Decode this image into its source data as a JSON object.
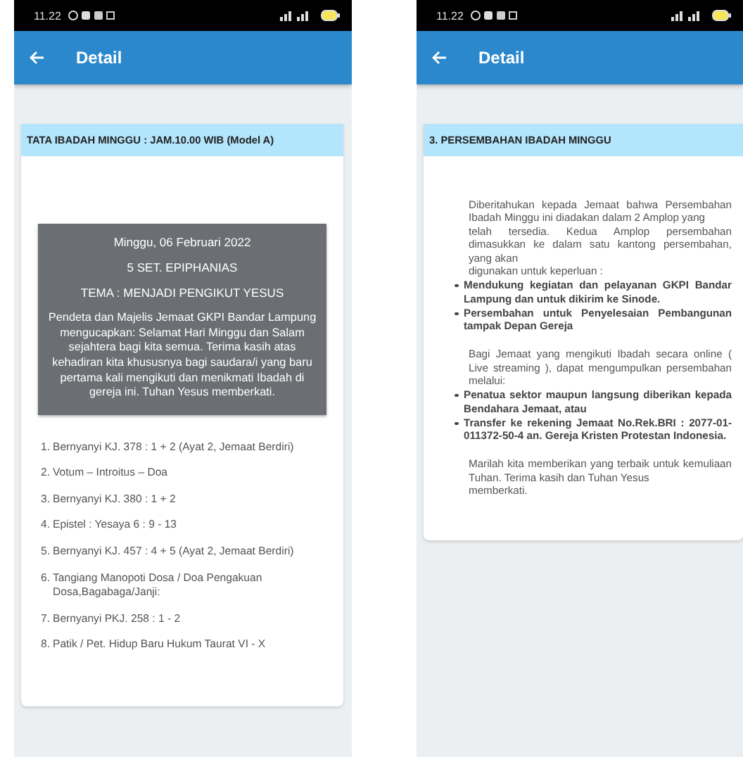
{
  "screens": [
    {
      "status_bar": {
        "time": "11.22"
      },
      "app_bar": {
        "title": "Detail"
      },
      "card": {
        "header": "TATA IBADAH MINGGU : JAM.10.00 WIB (Model A)",
        "sections": [
          {
            "kind": "banner",
            "lines": [
              "Minggu, 06 Februari 2022",
              "5 SET. EPIPHANIAS",
              "TEMA : MENJADI PENGIKUT YESUS"
            ],
            "paragraph": "Pendeta dan Majelis Jemaat GKPI Bandar Lampung mengucapkan: Selamat Hari Minggu dan Salam sejahtera bagi kita semua. Terima kasih atas kehadiran kita khususnya bagi saudara/i yang baru pertama kali mengikuti dan menikmati Ibadah di gereja ini. Tuhan Yesus memberkati."
          },
          {
            "kind": "numbered",
            "items": [
              {
                "number": "1.",
                "text": "Bernyanyi KJ. 378 : 1 + 2 (Ayat 2, Jemaat Berdiri)"
              },
              {
                "number": "2.",
                "text": "Votum – Introitus – Doa"
              },
              {
                "number": "3.",
                "text": "Bernyanyi KJ. 380 : 1 + 2"
              },
              {
                "number": "4.",
                "text": "Epistel : Yesaya 6 : 9 - 13"
              },
              {
                "number": "5.",
                "text": "Bernyanyi KJ. 457 : 4 + 5 (Ayat 2, Jemaat Berdiri)"
              },
              {
                "number": "6.",
                "text": "Tangiang Manopoti Dosa / Doa Pengakuan Dosa,Bagabaga/Janji:"
              },
              {
                "number": "7.",
                "text": "Bernyanyi PKJ. 258 : 1 - 2"
              },
              {
                "number": "8.",
                "text": "Patik / Pet. Hidup Baru Hukum Taurat VI - X"
              }
            ]
          }
        ]
      }
    },
    {
      "status_bar": {
        "time": "11.22"
      },
      "app_bar": {
        "title": "Detail"
      },
      "card": {
        "header": "3. PERSEMBAHAN IBADAH MINGGU",
        "sections": [
          {
            "kind": "paragraph",
            "lines": [
              "Diberitahukan kepada Jemaat bahwa Persembahan Ibadah Minggu ini diadakan dalam 2 Amplop yang",
              "telah tersedia. Kedua Amplop persembahan dimasukkan ke dalam satu kantong persembahan, yang akan",
              "digunakan untuk keperluan :"
            ]
          },
          {
            "kind": "bullets",
            "items": [
              "Mendukung kegiatan dan pelayanan GKPI Bandar Lampung dan untuk dikirim ke Sinode.",
              "Persembahan untuk Penyelesaian Pembangunan tampak Depan Gereja"
            ]
          },
          {
            "kind": "paragraph",
            "lines": [
              "Bagi Jemaat yang mengikuti Ibadah secara online ( Live streaming ), dapat mengumpulkan persembahan melalui:"
            ]
          },
          {
            "kind": "bullets",
            "items": [
              "Penatua sektor maupun langsung diberikan kepada Bendahara Jemaat, atau",
              "Transfer ke rekening Jemaat No.Rek.BRI : 2077-01-011372-50-4 an. Gereja Kristen Protestan Indonesia."
            ]
          },
          {
            "kind": "paragraph",
            "lines": [
              "Marilah kita memberikan yang terbaik untuk kemuliaan Tuhan. Terima kasih dan Tuhan Yesus",
              "memberkati."
            ]
          }
        ]
      }
    }
  ]
}
